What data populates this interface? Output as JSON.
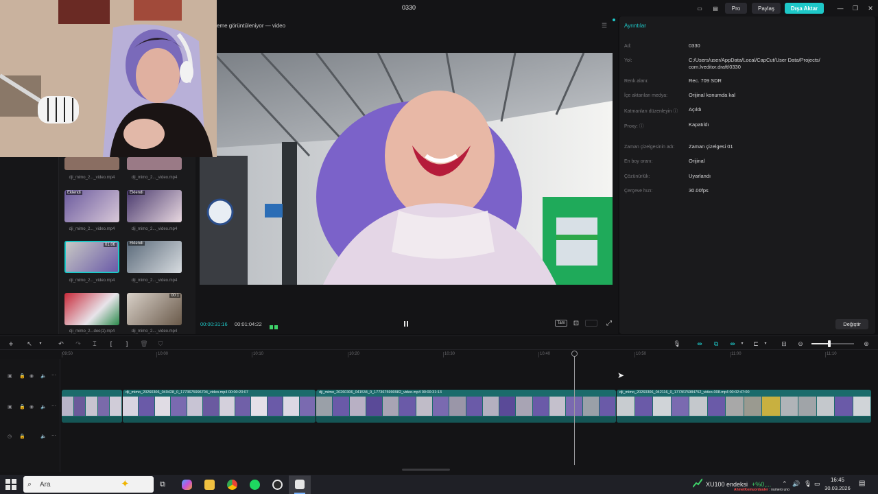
{
  "window": {
    "title": "0330"
  },
  "titlebar": {
    "pro": "Pro",
    "share": "Paylaş",
    "export": "Dışa Aktar"
  },
  "player": {
    "header": "eme görüntüleniyor — video",
    "time_current": "00:00:31:16",
    "time_total": "00:01:04:22",
    "full_label": "Tam"
  },
  "media": {
    "items": [
      {
        "name": "dji_mimo_2..._video.mp4",
        "added": ""
      },
      {
        "name": "dji_mimo_2..._video.mp4",
        "added": ""
      },
      {
        "name": "dji_mimo_2..._video.mp4",
        "added": "Eklendi"
      },
      {
        "name": "dji_mimo_2..._video.mp4",
        "added": "Eklendi"
      },
      {
        "name": "dji_mimo_2..._video.mp4",
        "added": ""
      },
      {
        "name": "dji_mimo_2..._video.mp4",
        "added": "Eklendi"
      },
      {
        "name": "dji_mimo_2...deo(1).mp4",
        "added": ""
      },
      {
        "name": "dji_mimo_2..._video.mp4",
        "added": ""
      }
    ],
    "durations": [
      "01:06",
      "00:1"
    ]
  },
  "details": {
    "title": "Ayrıntılar",
    "rows": [
      {
        "label": "Ad:",
        "value": "0330"
      },
      {
        "label": "Yol:",
        "value": "C:/Users/user/AppData/Local/CapCut/User Data/Projects/"
      },
      {
        "label": "",
        "value": "com.lveditor.draft/0330"
      },
      {
        "label": "Renk alanı:",
        "value": "Rec. 709 SDR"
      },
      {
        "label": "İçe aktarılan medya:",
        "value": "Orijinal konumda kal"
      },
      {
        "label": "Katmanları düzenleyin ⓘ",
        "value": "Açıldı"
      },
      {
        "label": "Proxy: ⓘ",
        "value": "Kapatıldı"
      },
      {
        "label": "Zaman çizelgesinin adı:",
        "value": "Zaman çizelgesi 01"
      },
      {
        "label": "En boy oranı:",
        "value": "Orijinal"
      },
      {
        "label": "Çözünürlük:",
        "value": "Uyarlandı"
      },
      {
        "label": "Çerçeve hızı:",
        "value": "30.00fps"
      }
    ],
    "change_button": "Değiştir"
  },
  "timeline": {
    "ruler": [
      "09:50",
      "10:00",
      "10:10",
      "10:20",
      "10:30",
      "10:40",
      "10:50",
      "11:00",
      "11:10"
    ],
    "clips": [
      {
        "label": "dji_mimo_20260306_040428_0_1773675996704_video.mp4   00:00:20:07"
      },
      {
        "label": "dji_mimo_20260306_041534_0_1773675990982_video.mp4   00:00:31:13"
      },
      {
        "label": "dji_mimo_20260306_042116_0_1773675984752_video-008.mp4   00:02:47:00"
      }
    ]
  },
  "taskbar": {
    "search_placeholder": "Ara",
    "stock_name": "XU100 endeksi",
    "stock_change": "+%0,...",
    "time": "16:45",
    "date": "30.03.2026",
    "ticker_user": "AhmetKomuorduuler",
    "ticker_text": ": numero uno"
  },
  "colors": {
    "accent": "#1ec8c8",
    "clip": "#1b6b6b"
  }
}
